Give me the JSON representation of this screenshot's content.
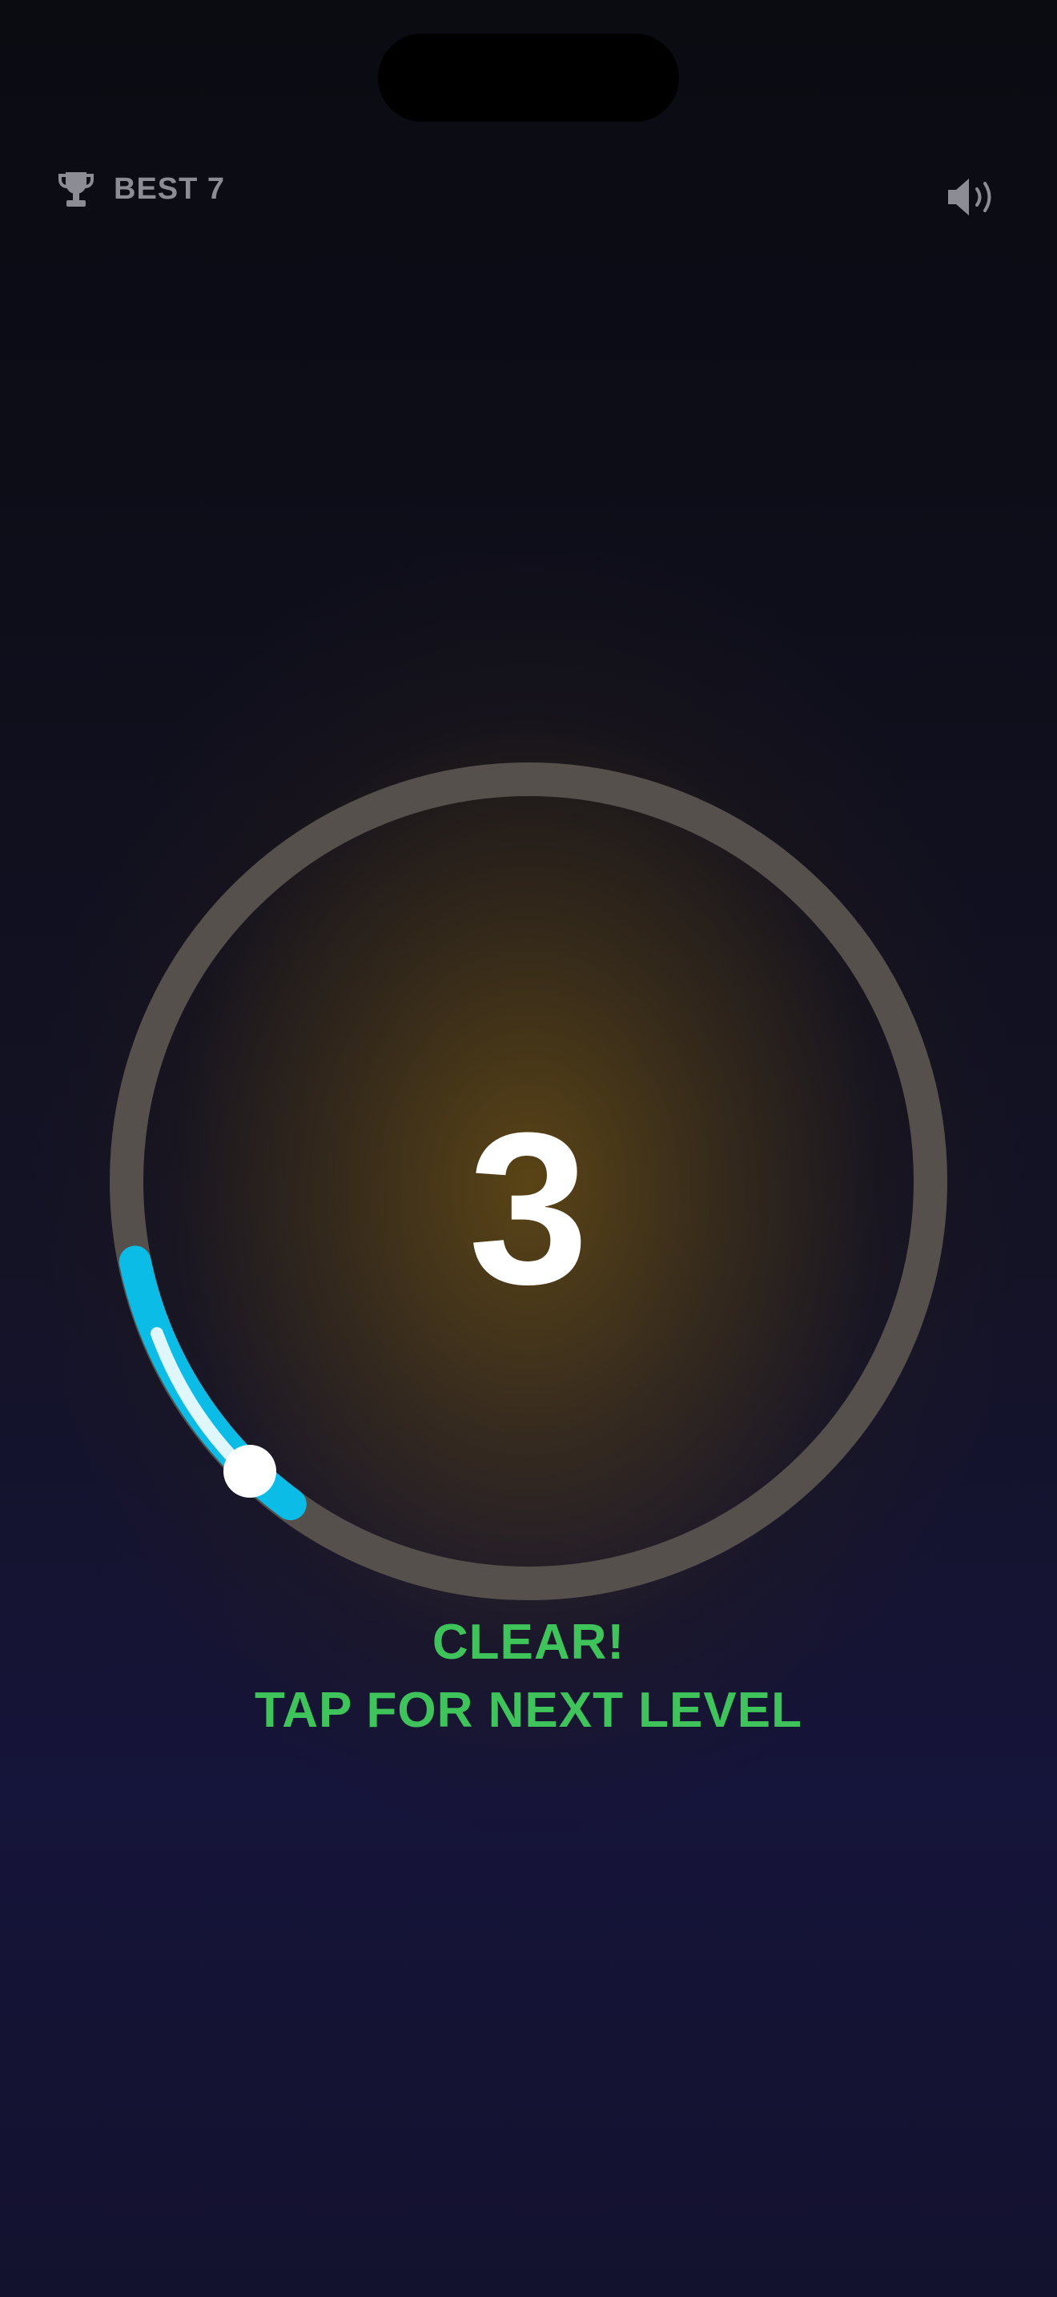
{
  "hud": {
    "best_label": "BEST 7",
    "trophy_icon": "trophy-icon",
    "sound_icon": "speaker-volume-icon"
  },
  "game": {
    "level": "3",
    "status": "CLEAR!",
    "prompt": "TAP FOR NEXT LEVEL"
  },
  "colors": {
    "accent_arc": "#0bbde6",
    "status_text": "#3ec45b",
    "ring_track": "#56504c",
    "hud_text": "#8c8c94"
  }
}
